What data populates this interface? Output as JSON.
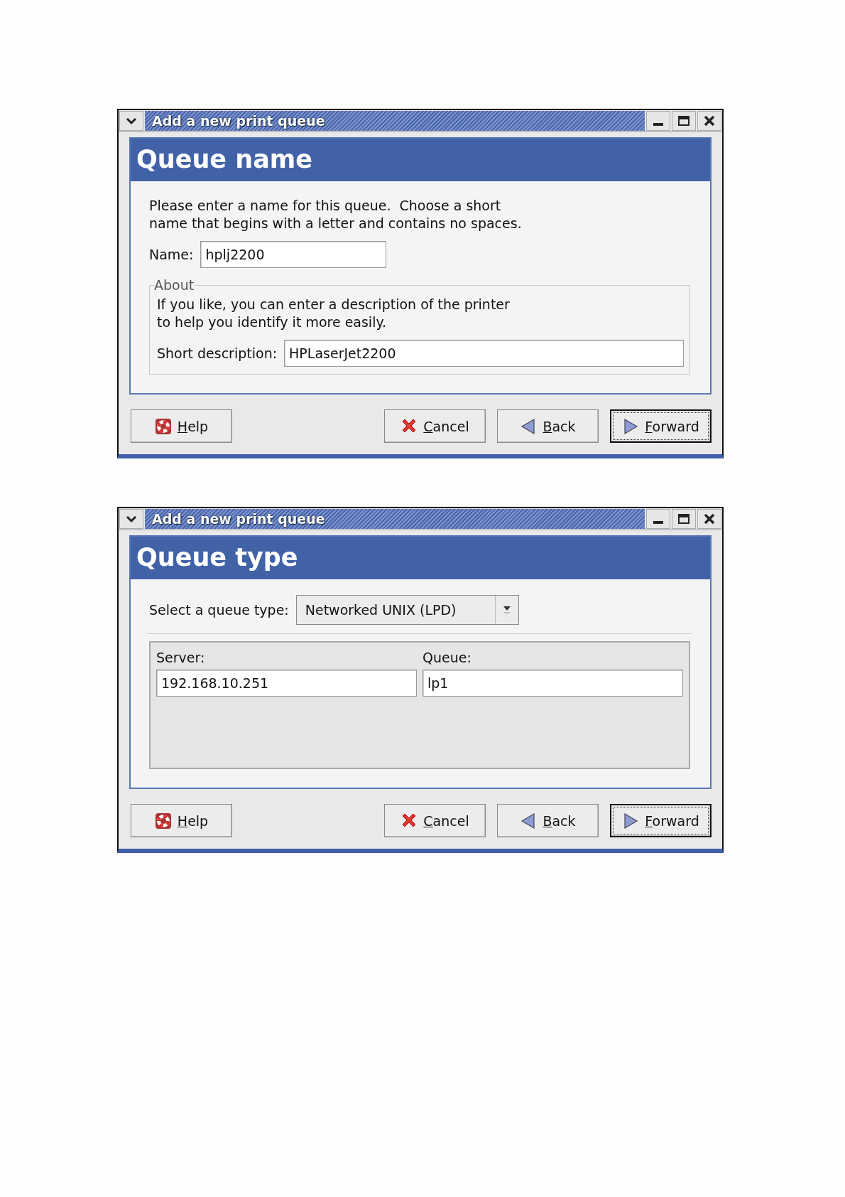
{
  "dialogs": [
    {
      "title": "Add a new print queue",
      "heading": "Queue name",
      "body": [
        {
          "kind": "text",
          "text": "Please enter a name for this queue.  Choose a short\nname that begins with a letter and contains no spaces."
        },
        {
          "kind": "field_row",
          "label": "Name:",
          "value": "hplj2200"
        },
        {
          "kind": "group",
          "legend": "About",
          "items": [
            {
              "kind": "text",
              "text": "If you like, you can enter a description of the printer\nto help you identify it more easily."
            },
            {
              "kind": "field_row",
              "label": "Short description:",
              "value": "HPLaserJet2200"
            }
          ]
        }
      ],
      "buttons": [
        {
          "label": "Help",
          "kind": "help",
          "focused": false
        },
        {
          "label": "Cancel",
          "kind": "cancel",
          "focused": false
        },
        {
          "label": "Back",
          "kind": "back",
          "focused": false
        },
        {
          "label": "Forward",
          "kind": "forward",
          "focused": true
        }
      ]
    },
    {
      "title": "Add a new print queue",
      "heading": "Queue type",
      "body": [
        {
          "kind": "combo_row",
          "label": "Select a queue type:",
          "value": "Networked UNIX (LPD)"
        },
        {
          "kind": "columns",
          "fields": [
            {
              "label": "Server:",
              "value": "192.168.10.251"
            },
            {
              "label": "Queue:",
              "value": "lp1"
            }
          ]
        }
      ],
      "buttons": [
        {
          "label": "Help",
          "kind": "help",
          "focused": false
        },
        {
          "label": "Cancel",
          "kind": "cancel",
          "focused": false
        },
        {
          "label": "Back",
          "kind": "back",
          "focused": false
        },
        {
          "label": "Forward",
          "kind": "forward",
          "focused": true
        }
      ]
    }
  ]
}
